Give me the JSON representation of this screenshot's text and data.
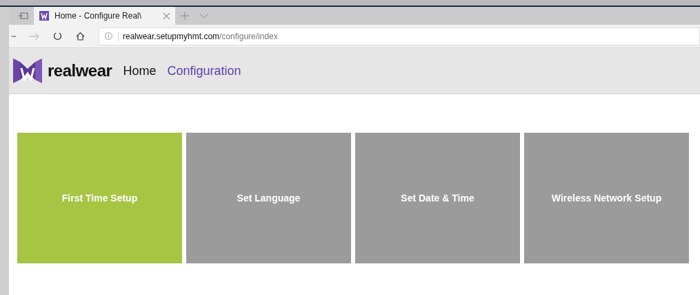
{
  "browser": {
    "tab_title": "Home - Configure Real\\",
    "address_host": "realwear.setupmyhmt.com",
    "address_path": "/configure/index"
  },
  "header": {
    "logo_text": "realwear",
    "nav": [
      {
        "label": "Home",
        "selected": false
      },
      {
        "label": "Configuration",
        "selected": true
      }
    ]
  },
  "tiles": [
    {
      "label": "First Time Setup",
      "selected": true
    },
    {
      "label": "Set Language",
      "selected": false
    },
    {
      "label": "Set Date & Time",
      "selected": false
    },
    {
      "label": "Wireless Network Setup",
      "selected": false
    }
  ]
}
